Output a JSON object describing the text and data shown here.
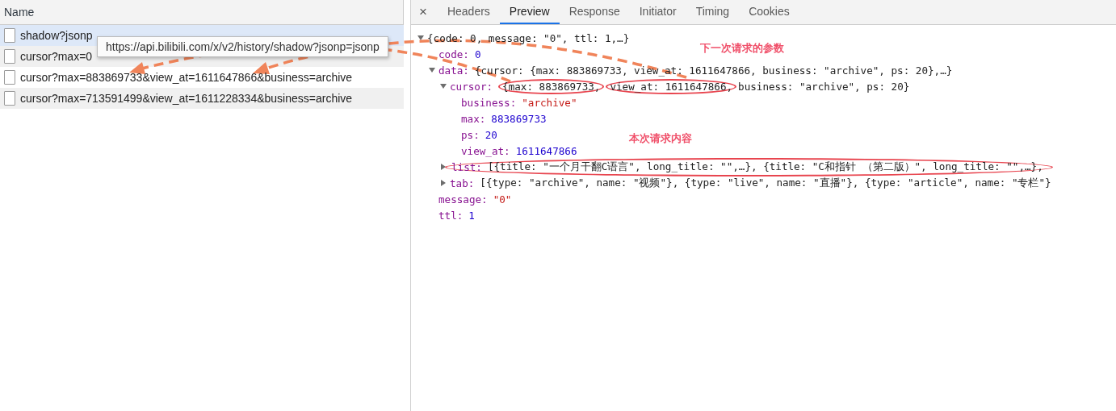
{
  "requests": {
    "header": "Name",
    "rows": [
      {
        "name": "shadow?jsonp",
        "selected": true
      },
      {
        "name": "cursor?max=0",
        "selected": false
      },
      {
        "name": "cursor?max=883869733&view_at=1611647866&business=archive",
        "selected": false
      },
      {
        "name": "cursor?max=713591499&view_at=1611228334&business=archive",
        "selected": false
      }
    ]
  },
  "tooltip": "https://api.bilibili.com/x/v2/history/shadow?jsonp=jsonp",
  "detail": {
    "close": "×",
    "tabs": [
      {
        "label": "Headers",
        "selected": false
      },
      {
        "label": "Preview",
        "selected": true
      },
      {
        "label": "Response",
        "selected": false
      },
      {
        "label": "Initiator",
        "selected": false
      },
      {
        "label": "Timing",
        "selected": false
      },
      {
        "label": "Cookies",
        "selected": false
      }
    ],
    "tree": [
      {
        "expanded": true,
        "summary": [
          {
            "text": "{code: 0, message: \"0\", ttl: 1,…}",
            "circled": false
          }
        ],
        "children": [
          {
            "key": "code:",
            "value": "0",
            "kind": "number"
          },
          {
            "key": "data:",
            "expanded": true,
            "summary": [
              {
                "text": "{cursor: {max: 883869733, view_at: 1611647866, business: \"archive\", ps: 20},…}",
                "circled": false
              }
            ],
            "children": [
              {
                "key": "cursor:",
                "expanded": true,
                "summary": [
                  {
                    "text": "{max: 883869733,",
                    "circled": true
                  },
                  {
                    "text": "view_at: 1611647866,",
                    "circled": true
                  },
                  {
                    "text": "business: \"archive\", ps: 20}",
                    "circled": false
                  }
                ],
                "children": [
                  {
                    "key": "business:",
                    "value": "\"archive\"",
                    "kind": "string"
                  },
                  {
                    "key": "max:",
                    "value": "883869733",
                    "kind": "number"
                  },
                  {
                    "key": "ps:",
                    "value": "20",
                    "kind": "number"
                  },
                  {
                    "key": "view_at:",
                    "value": "1611647866",
                    "kind": "number"
                  }
                ]
              },
              {
                "key": "list:",
                "expanded": false,
                "circled": true,
                "summary": [
                  {
                    "text": "[{title: \"一个月干翻C语言\", long_title: \"\",…}, {title: \"C和指针 （第二版）\", long_title: \"\",…},",
                    "circled": false
                  }
                ]
              },
              {
                "key": "tab:",
                "expanded": false,
                "summary": [
                  {
                    "text": "[{type: \"archive\", name: \"视频\"}, {type: \"live\", name: \"直播\"}, {type: \"article\", name: \"专栏\"}",
                    "circled": false
                  }
                ]
              }
            ]
          },
          {
            "key": "message:",
            "value": "\"0\"",
            "kind": "string"
          },
          {
            "key": "ttl:",
            "value": "1",
            "kind": "number"
          }
        ]
      }
    ]
  },
  "annotations": [
    "下一次请求的参数",
    "本次请求内容"
  ]
}
